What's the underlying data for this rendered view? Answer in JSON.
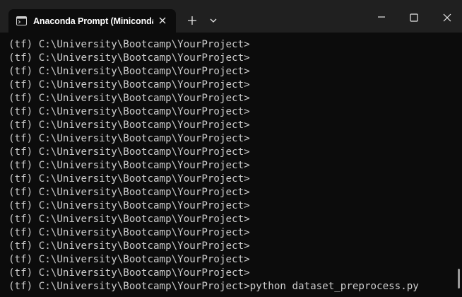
{
  "window": {
    "tab_title": "Anaconda Prompt (Miniconda",
    "tab_icon": "terminal-icon",
    "buttons": {
      "close_tab": "close-icon",
      "new_tab": "plus-icon",
      "tab_dropdown": "chevron-down-icon",
      "minimize": "minimize-icon",
      "maximize": "maximize-icon",
      "close_window": "close-icon"
    }
  },
  "colors": {
    "titlebar": "#202020",
    "console_bg": "#0c0c0c",
    "console_text": "#cccccc",
    "tab_text": "#ffffff"
  },
  "console": {
    "lines": [
      "(tf) C:\\University\\Bootcamp\\YourProject>",
      "(tf) C:\\University\\Bootcamp\\YourProject>",
      "(tf) C:\\University\\Bootcamp\\YourProject>",
      "(tf) C:\\University\\Bootcamp\\YourProject>",
      "(tf) C:\\University\\Bootcamp\\YourProject>",
      "(tf) C:\\University\\Bootcamp\\YourProject>",
      "(tf) C:\\University\\Bootcamp\\YourProject>",
      "(tf) C:\\University\\Bootcamp\\YourProject>",
      "(tf) C:\\University\\Bootcamp\\YourProject>",
      "(tf) C:\\University\\Bootcamp\\YourProject>",
      "(tf) C:\\University\\Bootcamp\\YourProject>",
      "(tf) C:\\University\\Bootcamp\\YourProject>",
      "(tf) C:\\University\\Bootcamp\\YourProject>",
      "(tf) C:\\University\\Bootcamp\\YourProject>",
      "(tf) C:\\University\\Bootcamp\\YourProject>",
      "(tf) C:\\University\\Bootcamp\\YourProject>",
      "(tf) C:\\University\\Bootcamp\\YourProject>",
      "(tf) C:\\University\\Bootcamp\\YourProject>",
      "(tf) C:\\University\\Bootcamp\\YourProject>python dataset_preprocess.py"
    ]
  }
}
